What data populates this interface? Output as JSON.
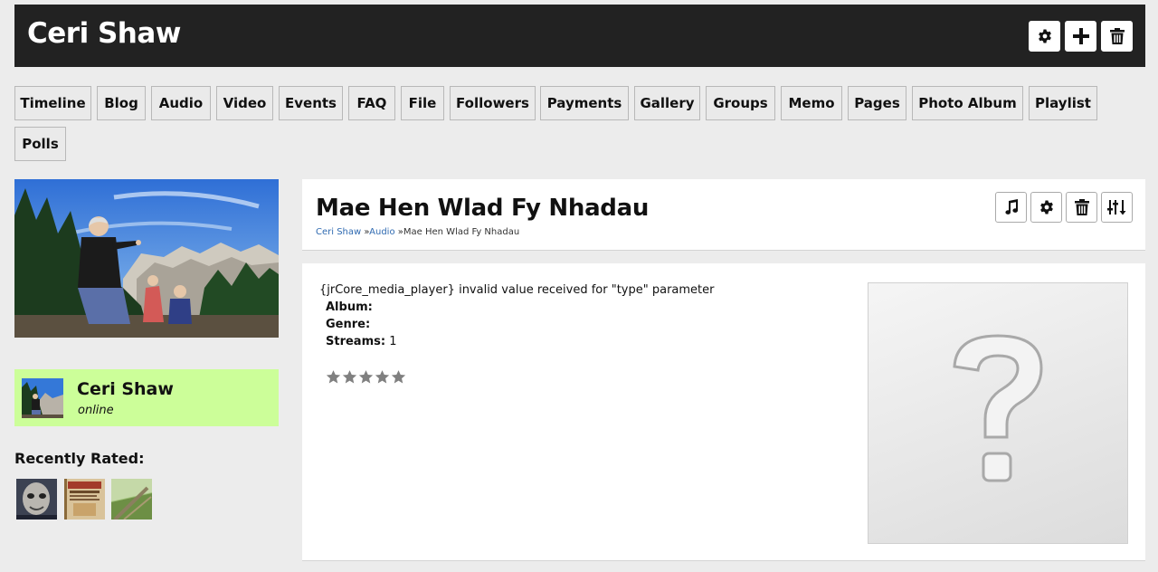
{
  "header": {
    "title": "Ceri Shaw",
    "actions": [
      "gear-icon",
      "plus-icon",
      "trash-icon"
    ]
  },
  "tabs": [
    {
      "label": "Timeline"
    },
    {
      "label": "Blog"
    },
    {
      "label": "Audio"
    },
    {
      "label": "Video"
    },
    {
      "label": "Events"
    },
    {
      "label": "FAQ"
    },
    {
      "label": "File"
    },
    {
      "label": "Followers"
    },
    {
      "label": "Payments"
    },
    {
      "label": "Gallery"
    },
    {
      "label": "Groups"
    },
    {
      "label": "Memo"
    },
    {
      "label": "Pages"
    },
    {
      "label": "Photo Album"
    },
    {
      "label": "Playlist"
    },
    {
      "label": "Polls"
    }
  ],
  "sidebar": {
    "user": {
      "name": "Ceri Shaw",
      "status": "online"
    },
    "recently_rated_title": "Recently Rated:",
    "recently_rated_count": 3
  },
  "item": {
    "title": "Mae Hen Wlad Fy Nhadau",
    "breadcrumb": {
      "home": "Ceri Shaw",
      "sep": "»",
      "section": "Audio",
      "current": "Mae Hen Wlad Fy Nhadau"
    },
    "actions": [
      "music-note-icon",
      "gear-icon",
      "trash-icon",
      "sliders-icon"
    ],
    "error": "{jrCore_media_player} invalid value received for \"type\" parameter",
    "album_label": "Album:",
    "album_value": "",
    "genre_label": "Genre:",
    "genre_value": "",
    "streams_label": "Streams:",
    "streams_value": "1",
    "rating_stars": 5,
    "rating_value": 0,
    "image_placeholder": "question-mark-icon"
  },
  "colors": {
    "header_bg": "#222222",
    "user_card_bg": "#ccfe99",
    "link": "#2f6ab1",
    "star": "#808080"
  }
}
